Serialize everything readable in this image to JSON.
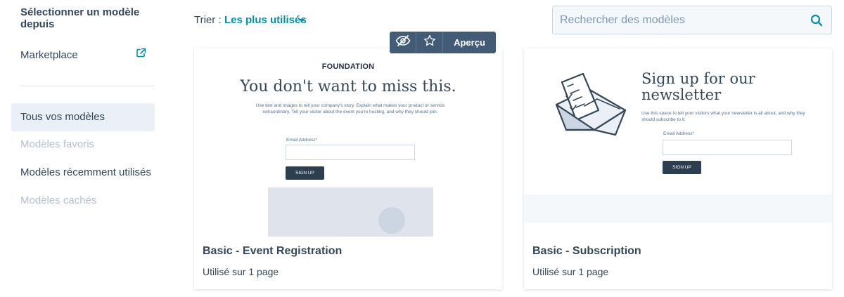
{
  "sidebar": {
    "heading": "Sélectionner un modèle depuis",
    "marketplace": "Marketplace",
    "items": [
      {
        "label": "Tous vos modèles"
      },
      {
        "label": "Modèles favoris"
      },
      {
        "label": "Modèles récemment utilisés"
      },
      {
        "label": "Modèles cachés"
      }
    ]
  },
  "sort": {
    "label": "Trier :",
    "value": "Les plus utilisés"
  },
  "search": {
    "placeholder": "Rechercher des modèles"
  },
  "toolbar": {
    "preview_label": "Aperçu"
  },
  "cards": [
    {
      "title": "Basic - Event Registration",
      "usage": "Utilisé sur 1 page",
      "thumbnail": {
        "brand": "FOUNDATION",
        "headline": "You don't want to miss this.",
        "body": "Use text and images to tell your company's story. Explain what makes your product or service extraordinary. Tell your visitor about the event you're hosting, and why they should join.",
        "email_label": "Email Address*",
        "button": "SIGN UP"
      }
    },
    {
      "title": "Basic - Subscription",
      "usage": "Utilisé sur 1 page",
      "thumbnail": {
        "headline": "Sign up for our newsletter",
        "body": "Use this space to tell your visitors what your newsletter is all about, and why they should subscribe to it.",
        "email_label": "Email Address*",
        "button": "SIGN UP"
      }
    }
  ],
  "colors": {
    "accent": "#0091ae",
    "text": "#33475b",
    "muted": "#b0c1d4",
    "active_bg": "#eaf0f6",
    "toolbar_bg": "#425b76"
  },
  "icons": [
    "external-link-icon",
    "search-icon",
    "hide-icon",
    "star-icon",
    "envelope-illustration"
  ]
}
